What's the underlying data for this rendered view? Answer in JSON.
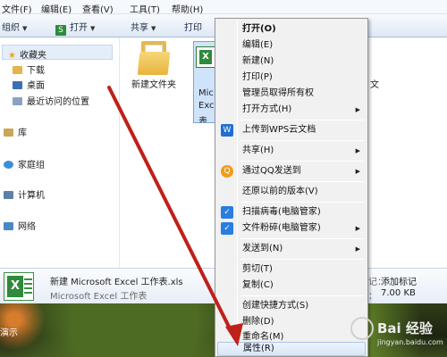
{
  "menubar": {
    "items": [
      "文件(F)",
      "编辑(E)",
      "查看(V)",
      "工具(T)",
      "帮助(H)"
    ]
  },
  "toolbar": {
    "organize": "组织",
    "open": "打开",
    "share": "共享",
    "print": "打印"
  },
  "sidebar": {
    "favorites": "收藏夹",
    "downloads": "下载",
    "desktop": "桌面",
    "recent": "最近访问的位置",
    "libraries": "库",
    "homegroup": "家庭组",
    "computer": "计算机",
    "network": "网络"
  },
  "content": {
    "new_folder": "新建文件夹",
    "selected_label_1": "Mic",
    "selected_label_2": "Exce",
    "selected_label_3": "表",
    "right_text": "文"
  },
  "details": {
    "file_name": "新建 Microsoft Excel 工作表.xls",
    "file_type": "Microsoft Excel 工作表",
    "mark_partial": "记：",
    "add_tag": "添加标记",
    "size_partial": "：",
    "size_value": "7.00 KB"
  },
  "desktop": {
    "corner_text": "演示"
  },
  "context_menu": {
    "open": "打开(O)",
    "edit": "编辑(E)",
    "new": "新建(N)",
    "print": "打印(P)",
    "admin_ownership": "管理员取得所有权",
    "open_with": "打开方式(H)",
    "upload_wps": "上传到WPS云文档",
    "share": "共享(H)",
    "send_qq": "通过QQ发送到",
    "restore_versions": "还原以前的版本(V)",
    "scan_virus": "扫描病毒(电脑管家)",
    "shred_file": "文件粉碎(电脑管家)",
    "send_to": "发送到(N)",
    "cut": "剪切(T)",
    "copy": "复制(C)",
    "create_shortcut": "创建快捷方式(S)",
    "delete": "删除(D)",
    "rename": "重命名(M)",
    "properties": "属性(R)"
  },
  "watermark": {
    "brand": "Bai 经验",
    "url": "jingyan.baidu.com"
  },
  "colors": {
    "arrow": "#c0201a",
    "excel_green": "#2f8a3b",
    "wps_blue": "#1f6fd1",
    "guard_blue": "#2a7de1",
    "qq_orange": "#f29a1f"
  },
  "icons": {
    "open_button": "open-icon",
    "favorites": "star-icon",
    "downloads": "download-folder-icon",
    "desktop": "desktop-icon",
    "recent": "recent-places-icon",
    "libraries": "library-icon",
    "homegroup": "homegroup-icon",
    "computer": "computer-icon",
    "network": "network-icon",
    "folder": "folder-icon",
    "excel": "excel-file-icon",
    "wps": "wps-cloud-icon",
    "qq": "qq-penguin-icon",
    "pc_manager": "pc-manager-shield-icon"
  }
}
